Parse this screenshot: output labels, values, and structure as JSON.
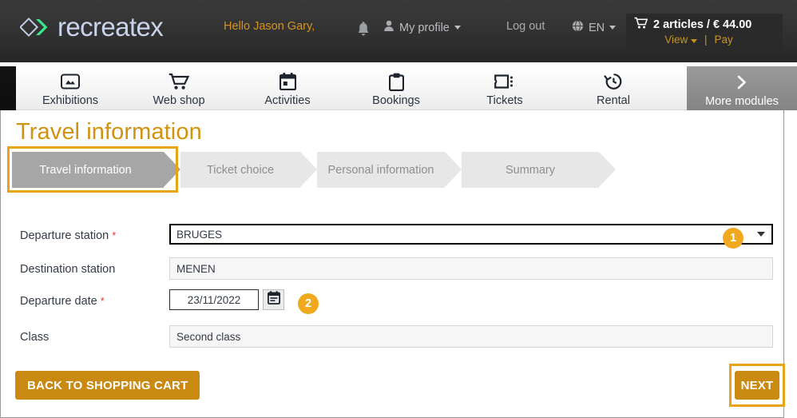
{
  "header": {
    "logo_text": "recreatex",
    "logo_icon": "diamond-chevron-logo",
    "greeting": "Hello Jason Gary,",
    "bell_icon": "bell-icon",
    "profile_icon": "user-icon",
    "profile_label": "My profile",
    "logout_label": "Log out",
    "globe_icon": "globe-icon",
    "language": "EN",
    "cart": {
      "cart_icon": "shopping-cart-icon",
      "summary": "2 articles / € 44.00",
      "view_label": "View",
      "separator": "|",
      "pay_label": "Pay"
    }
  },
  "nav": {
    "items": [
      {
        "label": "Exhibitions",
        "icon": "image-picture-icon"
      },
      {
        "label": "Web shop",
        "icon": "shopping-cart-icon"
      },
      {
        "label": "Activities",
        "icon": "calendar-icon"
      },
      {
        "label": "Bookings",
        "icon": "clipboard-icon"
      },
      {
        "label": "Tickets",
        "icon": "ticket-icon"
      },
      {
        "label": "Rental",
        "icon": "clock-history-icon"
      }
    ],
    "more": {
      "label": "More modules",
      "icon": "chevron-right-icon"
    }
  },
  "page": {
    "title": "Travel information",
    "steps": [
      {
        "label": "Travel information",
        "active": true
      },
      {
        "label": "Ticket choice",
        "active": false
      },
      {
        "label": "Personal information",
        "active": false
      },
      {
        "label": "Summary",
        "active": false
      }
    ]
  },
  "form": {
    "fields": [
      {
        "label": "Departure station",
        "required": true,
        "required_marker": "*",
        "type": "select",
        "value": "BRUGES"
      },
      {
        "label": "Destination station",
        "required": false,
        "required_marker": "",
        "type": "readonly",
        "value": "MENEN"
      },
      {
        "label": "Departure date",
        "required": true,
        "required_marker": "*",
        "type": "date",
        "value": "23/11/2022",
        "picker_icon": "calendar-icon"
      },
      {
        "label": "Class",
        "required": false,
        "required_marker": "",
        "type": "readonly",
        "value": "Second class"
      }
    ]
  },
  "annotations": [
    {
      "number": "1",
      "target": "departure-station-select"
    },
    {
      "number": "2",
      "target": "departure-date-picker"
    }
  ],
  "actions": {
    "back_label": "BACK TO SHOPPING CART",
    "next_label": "NEXT"
  },
  "colors": {
    "accent_gold": "#ca8a12",
    "highlight_gold": "#e8a317",
    "badge_gold": "#f0a91e",
    "title_gold": "#d1920f",
    "header_dark": "#333333",
    "step_active": "#a6a6a6",
    "step_inactive": "#e7e7e7",
    "logo_blue": "#c9d4ec",
    "logo_green": "#3ce68a"
  }
}
